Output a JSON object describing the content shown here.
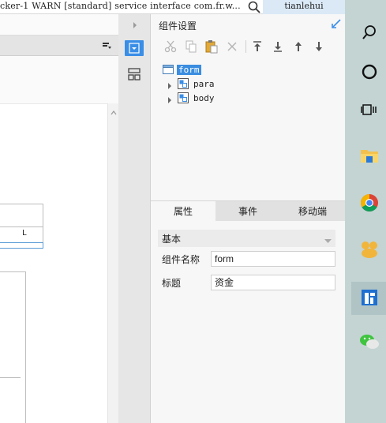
{
  "log_bar": {
    "text": "cker-1 WARN [standard] service interface com.fr.w..."
  },
  "user_bar": {
    "username": "tianlehui"
  },
  "editor": {
    "column_label": "L"
  },
  "panel": {
    "title": "组件设置",
    "tree": [
      {
        "label": "form",
        "selected": true,
        "expandable": false
      },
      {
        "label": "para",
        "selected": false,
        "expandable": true
      },
      {
        "label": "body",
        "selected": false,
        "expandable": true
      }
    ],
    "tabs": [
      {
        "label": "属性",
        "active": true
      },
      {
        "label": "事件",
        "active": false
      },
      {
        "label": "移动端",
        "active": false
      }
    ],
    "section_label": "基本",
    "properties": [
      {
        "label": "组件名称",
        "value": "form"
      },
      {
        "label": "标题",
        "value": "资金"
      }
    ]
  },
  "colors": {
    "accent": "#3a8ee6",
    "selection": "#3b8de0",
    "taskbar": "#c3d4d3"
  },
  "icons": {
    "toolbar": [
      "cut-icon",
      "copy-icon",
      "paste-icon",
      "delete-icon",
      "move-top-icon",
      "move-bottom-icon",
      "move-up-icon",
      "move-down-icon"
    ],
    "taskbar": [
      "search-icon",
      "cortana-icon",
      "task-view-icon",
      "file-explorer-icon",
      "chrome-icon",
      "app-icon",
      "finereport-icon",
      "wechat-icon"
    ]
  }
}
